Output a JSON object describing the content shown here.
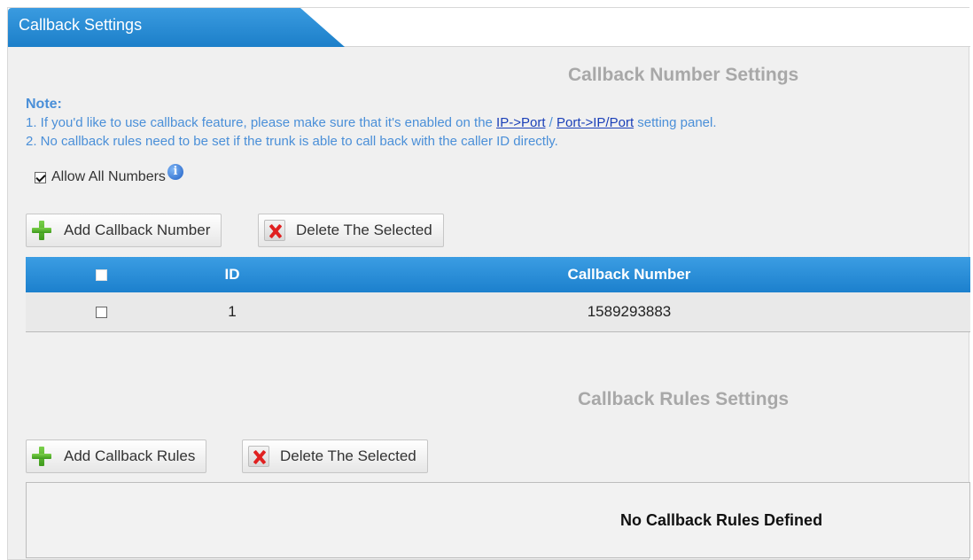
{
  "tab": {
    "title": "Callback Settings"
  },
  "number_section": {
    "title": "Callback Number Settings",
    "note": {
      "label": "Note:",
      "line1_prefix": "1. If you'd like to use callback feature, please make sure that it's enabled on the ",
      "link1": "IP->Port",
      "separator": " / ",
      "link2": "Port->IP/Port",
      "line1_suffix": " setting panel.",
      "line2": "2. No callback rules need to be set if the trunk is able to call back with the caller ID directly."
    },
    "allow_all": {
      "label": "Allow All Numbers",
      "checked": true,
      "info_icon": "info-icon",
      "info_glyph": "i"
    },
    "buttons": {
      "add_label": "Add Callback Number",
      "delete_label": "Delete The Selected"
    },
    "table": {
      "columns": [
        "",
        "ID",
        "Callback Number"
      ],
      "rows": [
        {
          "selected": false,
          "id": "1",
          "number": "1589293883"
        }
      ]
    }
  },
  "rules_section": {
    "title": "Callback Rules Settings",
    "buttons": {
      "add_label": "Add Callback Rules",
      "delete_label": "Delete The Selected"
    },
    "empty_message": "No Callback Rules Defined"
  },
  "colors": {
    "accent_blue": "#1c80cd",
    "note_text": "#4a8fd8",
    "link": "#1a3fb8",
    "add_icon": "#3e9a1c",
    "delete_icon": "#e02020"
  }
}
